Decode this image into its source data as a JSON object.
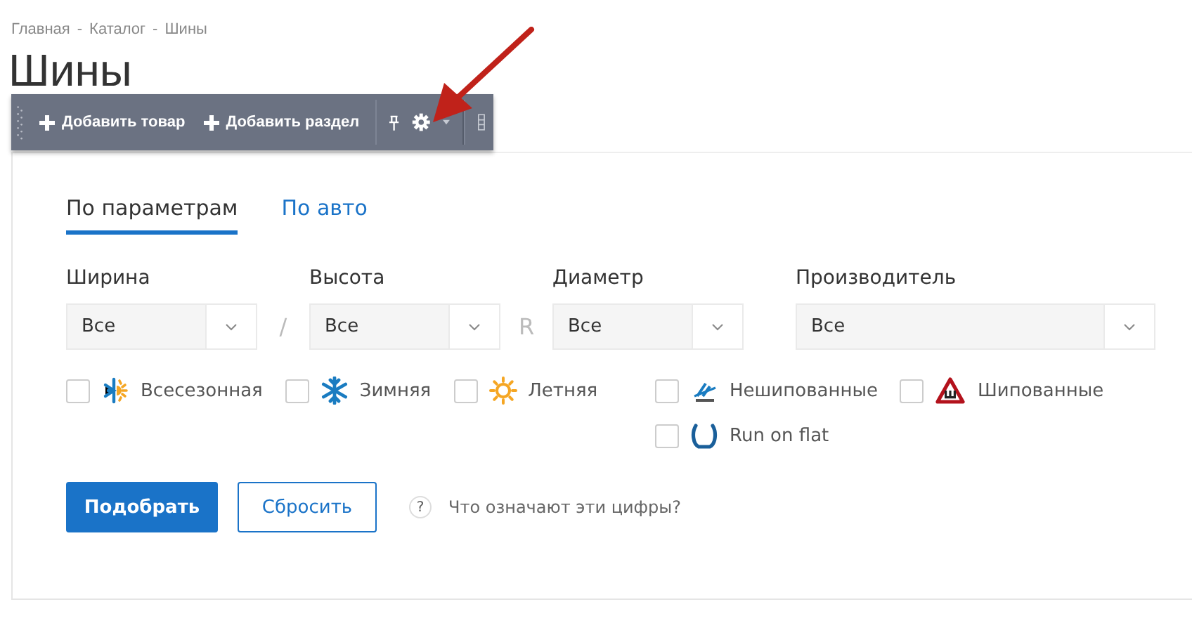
{
  "breadcrumbs": [
    "Главная",
    "Каталог",
    "Шины"
  ],
  "breadcrumb_separator": "-",
  "title": "Шины",
  "toolbar": {
    "buttons": [
      {
        "label": "Добавить товар"
      },
      {
        "label": "Добавить раздел"
      }
    ]
  },
  "tabs": [
    {
      "label": "По параметрам",
      "selected": true
    },
    {
      "label": "По авто",
      "selected": false
    }
  ],
  "filters": [
    {
      "label": "Ширина",
      "value": "Все",
      "separator": "/"
    },
    {
      "label": "Высота",
      "value": "Все",
      "separator": "R"
    },
    {
      "label": "Диаметр",
      "value": "Все"
    },
    {
      "label": "Производитель",
      "value": "Все"
    }
  ],
  "season_options": [
    {
      "label": "Всесезонная",
      "kind": "allseason",
      "checked": false
    },
    {
      "label": "Зимняя",
      "kind": "winter",
      "checked": false
    },
    {
      "label": "Летняя",
      "kind": "summer",
      "checked": false
    }
  ],
  "type_options": [
    {
      "label": "Нешипованные",
      "kind": "studless",
      "checked": false
    },
    {
      "label": "Шипованные",
      "kind": "studded",
      "checked": false
    },
    {
      "label": "Run on flat",
      "kind": "runflat",
      "checked": false
    }
  ],
  "buttons": {
    "submit": "Подобрать",
    "reset": "Сбросить"
  },
  "help_link": {
    "icon": "?",
    "label": "Что означают эти цифры?"
  }
}
